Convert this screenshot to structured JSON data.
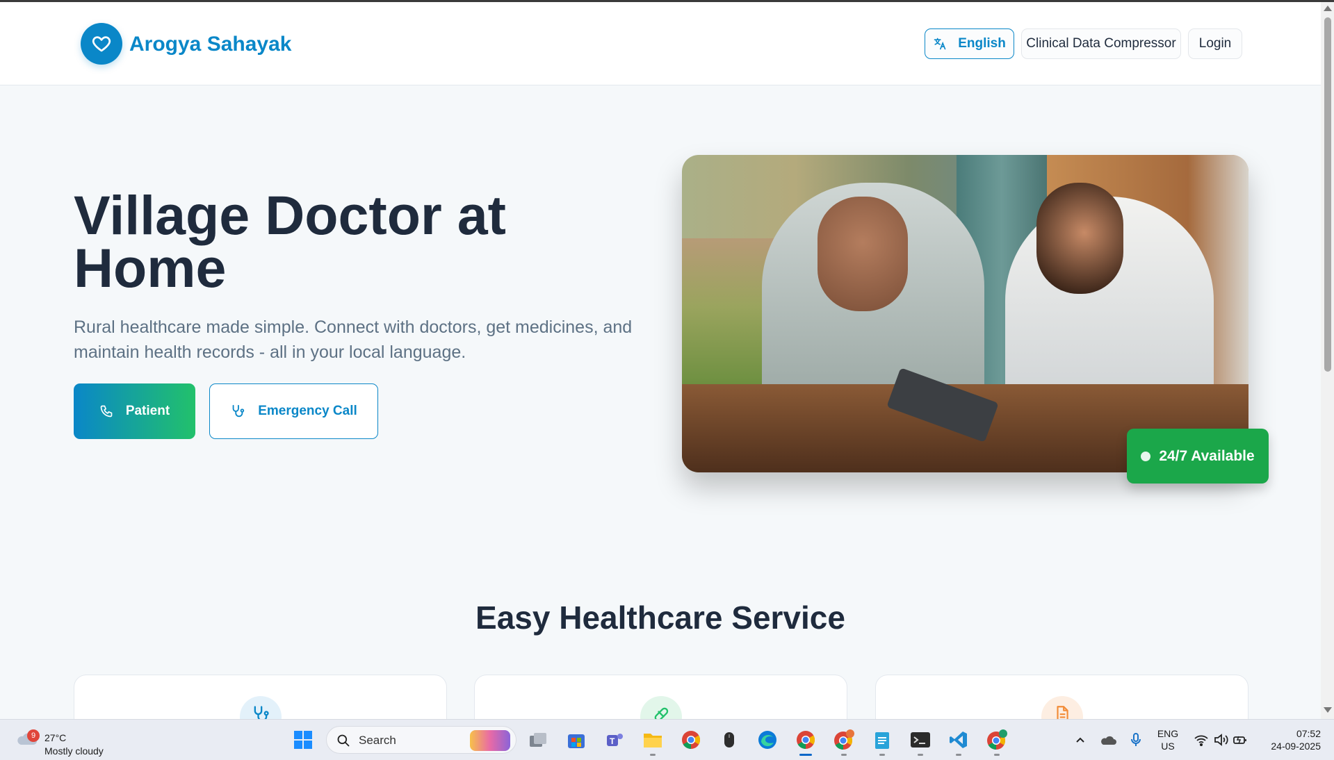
{
  "header": {
    "brand": "Arogya Sahayak",
    "language_label": "English",
    "compressor_label": "Clinical Data Compressor",
    "login_label": "Login"
  },
  "hero": {
    "title": "Village Doctor at Home",
    "subtitle": "Rural healthcare made simple. Connect with doctors, get medicines, and maintain health records - all in your local language.",
    "patient_button": "Patient",
    "emergency_button": "Emergency Call",
    "availability_badge": "24/7 Available"
  },
  "services": {
    "title": "Easy Healthcare Service",
    "cards": [
      {
        "icon": "stethoscope-icon",
        "color": "#0a87c8"
      },
      {
        "icon": "pill-icon",
        "color": "#22c16b"
      },
      {
        "icon": "file-icon",
        "color": "#f28c38"
      }
    ]
  },
  "colors": {
    "primary": "#0a87c8",
    "secondary": "#22c16b",
    "available_green": "#1ba74a",
    "heading": "#1f2b3d"
  },
  "taskbar": {
    "weather_badge": "9",
    "temperature": "27°C",
    "weather_desc": "Mostly cloudy",
    "search_placeholder": "Search",
    "lang_line1": "ENG",
    "lang_line2": "US",
    "time": "07:52",
    "date": "24-09-2025"
  }
}
